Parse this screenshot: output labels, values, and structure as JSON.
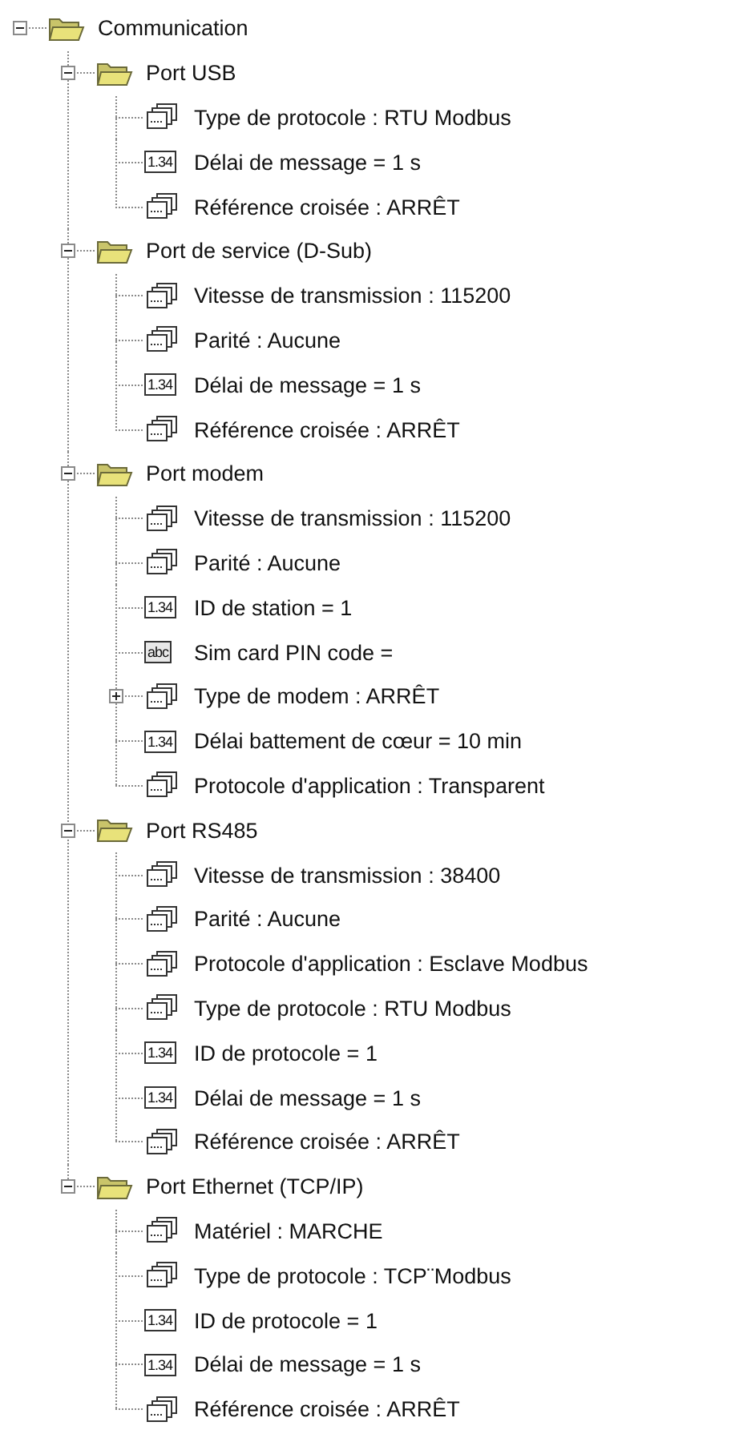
{
  "tree": {
    "label": "Communication",
    "kind": "folder",
    "expanded": true,
    "children": [
      {
        "label": "Port USB",
        "kind": "folder",
        "expanded": true,
        "children": [
          {
            "label": "Type de protocole : RTU Modbus",
            "kind": "list"
          },
          {
            "label": "Délai de message = 1 s",
            "kind": "number",
            "icon_label": "1.34"
          },
          {
            "label": "Référence croisée : ARRÊT",
            "kind": "list"
          }
        ]
      },
      {
        "label": "Port de service (D-Sub)",
        "kind": "folder",
        "expanded": true,
        "children": [
          {
            "label": "Vitesse de transmission : 115200",
            "kind": "list"
          },
          {
            "label": "Parité : Aucune",
            "kind": "list"
          },
          {
            "label": "Délai de message = 1 s",
            "kind": "number",
            "icon_label": "1.34"
          },
          {
            "label": "Référence croisée : ARRÊT",
            "kind": "list"
          }
        ]
      },
      {
        "label": "Port modem",
        "kind": "folder",
        "expanded": true,
        "children": [
          {
            "label": "Vitesse de transmission : 115200",
            "kind": "list"
          },
          {
            "label": "Parité : Aucune",
            "kind": "list"
          },
          {
            "label": "ID de station = 1",
            "kind": "number",
            "icon_label": "1.34"
          },
          {
            "label": "Sim card PIN code =",
            "kind": "text",
            "icon_label": "abc"
          },
          {
            "label": "Type de modem : ARRÊT",
            "kind": "list",
            "expanded": false
          },
          {
            "label": "Délai battement de cœur = 10 min",
            "kind": "number",
            "icon_label": "1.34"
          },
          {
            "label": "Protocole d'application : Transparent",
            "kind": "list"
          }
        ]
      },
      {
        "label": "Port RS485",
        "kind": "folder",
        "expanded": true,
        "children": [
          {
            "label": "Vitesse de transmission : 38400",
            "kind": "list"
          },
          {
            "label": "Parité : Aucune",
            "kind": "list"
          },
          {
            "label": "Protocole d'application : Esclave Modbus",
            "kind": "list"
          },
          {
            "label": "Type de protocole : RTU Modbus",
            "kind": "list"
          },
          {
            "label": "ID de protocole = 1",
            "kind": "number",
            "icon_label": "1.34"
          },
          {
            "label": "Délai de message = 1 s",
            "kind": "number",
            "icon_label": "1.34"
          },
          {
            "label": "Référence croisée : ARRÊT",
            "kind": "list"
          }
        ]
      },
      {
        "label": "Port Ethernet (TCP/IP)",
        "kind": "folder",
        "expanded": true,
        "children": [
          {
            "label": "Matériel : MARCHE",
            "kind": "list"
          },
          {
            "label": "Type de protocole : TCP¨Modbus",
            "kind": "list"
          },
          {
            "label": "ID de protocole = 1",
            "kind": "number",
            "icon_label": "1.34"
          },
          {
            "label": "Délai de message = 1 s",
            "kind": "number",
            "icon_label": "1.34"
          },
          {
            "label": "Référence croisée : ARRÊT",
            "kind": "list"
          }
        ]
      }
    ]
  }
}
